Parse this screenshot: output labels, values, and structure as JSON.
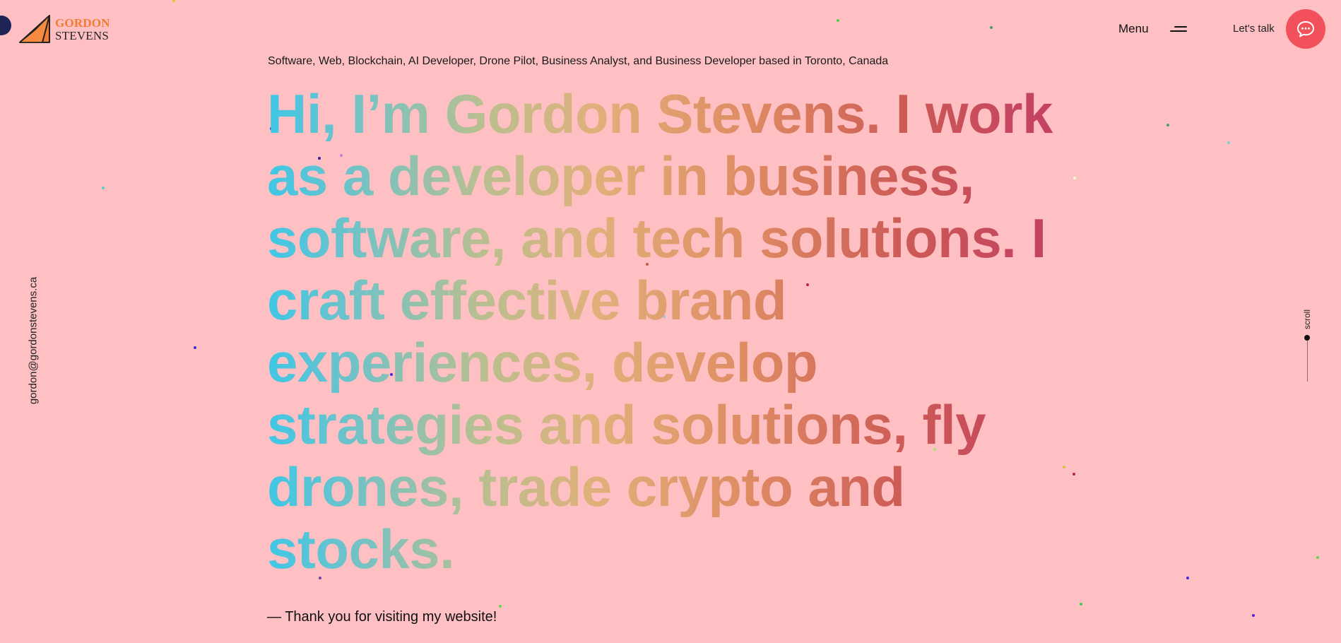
{
  "logo": {
    "line1": "GORDON",
    "line2": "STEVENS",
    "colors": {
      "primary": "#f27a32",
      "dark": "#222222"
    }
  },
  "header": {
    "menu_label": "Menu",
    "menu_icon": "hamburger-icon",
    "talk_label": "Let's talk",
    "talk_icon": "chat-bubble-icon",
    "talk_button_color": "#f2505a"
  },
  "side": {
    "email": "gordon@gordonstevens.ca",
    "scroll_label": "scroll"
  },
  "main": {
    "subtitle": "Software, Web, Blockchain, AI Developer, Drone Pilot, Business Analyst, and Business Developer based in Toronto, Canada",
    "headline_lines": [
      "Hi, I’m Gordon Stevens. I work",
      "as a developer in business,",
      "software, and tech solutions. I",
      "craft effective brand",
      "experiences, develop",
      "strategies and solutions, fly",
      "drones, trade crypto and",
      "stocks."
    ],
    "thanks": "— Thank you for visiting my website!"
  },
  "theme": {
    "background": "#ffc0c4",
    "gradient_colors": [
      "#3fc7e6",
      "#72c2c6",
      "#b8bf90",
      "#e0b07a",
      "#df8d64",
      "#cc5a55",
      "#c13a66"
    ]
  }
}
